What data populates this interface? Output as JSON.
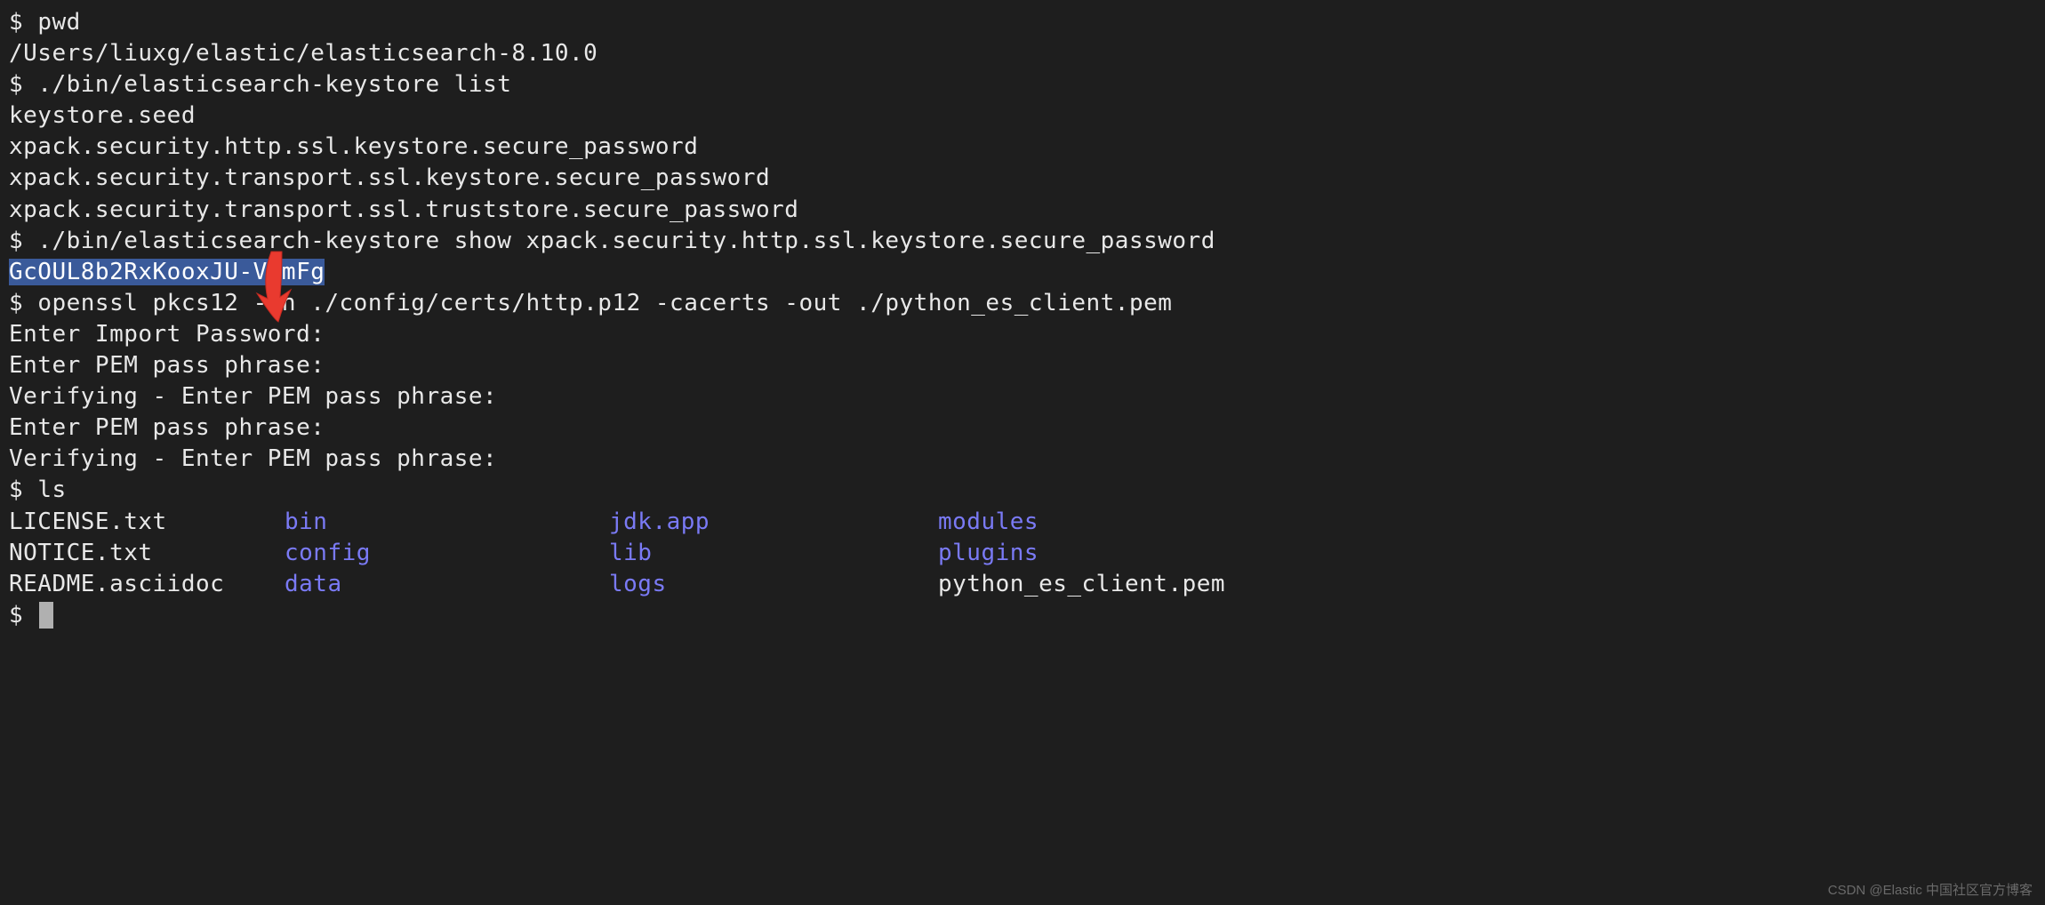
{
  "lines": {
    "l1_prompt": "$ ",
    "l1_cmd": "pwd",
    "l2": "/Users/liuxg/elastic/elasticsearch-8.10.0",
    "l3_prompt": "$ ",
    "l3_cmd": "./bin/elasticsearch-keystore list",
    "l4": "keystore.seed",
    "l5": "xpack.security.http.ssl.keystore.secure_password",
    "l6": "xpack.security.transport.ssl.keystore.secure_password",
    "l7": "xpack.security.transport.ssl.truststore.secure_password",
    "l8_prompt": "$ ",
    "l8_cmd": "./bin/elasticsearch-keystore show xpack.security.http.ssl.keystore.secure_password",
    "l9": "GcOUL8b2RxKooxJU-VymFg",
    "l10_prompt": "$ ",
    "l10_cmd": "openssl pkcs12 -in ./config/certs/http.p12 -cacerts -out ./python_es_client.pem",
    "l11": "Enter Import Password:",
    "l12": "Enter PEM pass phrase:",
    "l13": "Verifying - Enter PEM pass phrase:",
    "l14": "Enter PEM pass phrase:",
    "l15": "Verifying - Enter PEM pass phrase:",
    "l16_prompt": "$ ",
    "l16_cmd": "ls",
    "l19_prompt": "$ "
  },
  "ls": {
    "row1": {
      "c1": "LICENSE.txt",
      "c2": "bin",
      "c3": "jdk.app",
      "c4": "modules"
    },
    "row2": {
      "c1": "NOTICE.txt",
      "c2": "config",
      "c3": "lib",
      "c4": "plugins"
    },
    "row3": {
      "c1": "README.asciidoc",
      "c2": "data",
      "c3": "logs",
      "c4": "python_es_client.pem"
    }
  },
  "watermark": "CSDN @Elastic 中国社区官方博客"
}
